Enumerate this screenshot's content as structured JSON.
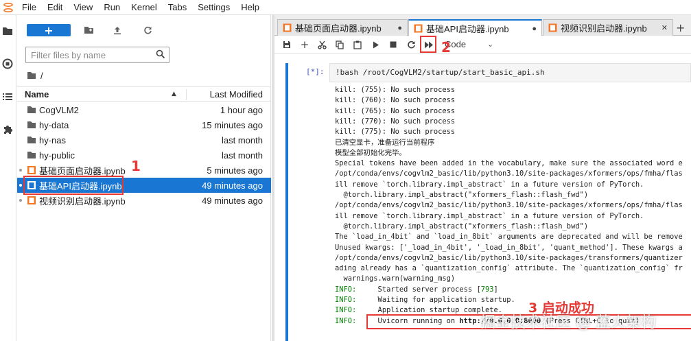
{
  "menu": {
    "items": [
      "File",
      "Edit",
      "View",
      "Run",
      "Kernel",
      "Tabs",
      "Settings",
      "Help"
    ]
  },
  "filebrowser": {
    "new_label": "+",
    "filter_placeholder": "Filter files by name",
    "breadcrumb": "/",
    "columns": {
      "name": "Name",
      "modified": "Last Modified"
    },
    "files": [
      {
        "name": "CogVLM2",
        "modified": "1 hour ago",
        "type": "folder"
      },
      {
        "name": "hy-data",
        "modified": "15 minutes ago",
        "type": "folder"
      },
      {
        "name": "hy-nas",
        "modified": "last month",
        "type": "folder"
      },
      {
        "name": "hy-public",
        "modified": "last month",
        "type": "folder"
      },
      {
        "name": "基础页面启动器.ipynb",
        "modified": "5 minutes ago",
        "type": "notebook",
        "running": true
      },
      {
        "name": "基础API启动器.ipynb",
        "modified": "49 minutes ago",
        "type": "notebook",
        "running": true,
        "selected": true
      },
      {
        "name": "视频识别启动器.ipynb",
        "modified": "49 minutes ago",
        "type": "notebook",
        "running": true
      }
    ]
  },
  "tabs": [
    {
      "label": "基础页面启动器.ipynb",
      "close": "●"
    },
    {
      "label": "基础API启动器.ipynb",
      "close": "●",
      "active": true
    },
    {
      "label": "视频识别启动器.ipynb",
      "close": "✕"
    }
  ],
  "tab_add": "+",
  "notebook": {
    "cell_type": "Code",
    "prompt": "[*]:",
    "input": "!bash /root/CogVLM2/startup/start_basic_api.sh",
    "output": [
      {
        "text": "kill: (755): No such process"
      },
      {
        "text": "kill: (760): No such process"
      },
      {
        "text": "kill: (765): No such process"
      },
      {
        "text": "kill: (770): No such process"
      },
      {
        "text": "kill: (775): No such process"
      },
      {
        "text": "已清空显卡，准备运行当前程序"
      },
      {
        "text": "模型全部初始化完毕。"
      },
      {
        "text": "Special tokens have been added in the vocabulary, make sure the associated word e"
      },
      {
        "text": "/opt/conda/envs/cogvlm2_basic/lib/python3.10/site-packages/xformers/ops/fmha/flas"
      },
      {
        "text": "ill remove `torch.library.impl_abstract` in a future version of PyTorch."
      },
      {
        "text": "  @torch.library.impl_abstract(\"xformers_flash::flash_fwd\")"
      },
      {
        "text": "/opt/conda/envs/cogvlm2_basic/lib/python3.10/site-packages/xformers/ops/fmha/flas"
      },
      {
        "text": "ill remove `torch.library.impl_abstract` in a future version of PyTorch."
      },
      {
        "text": "  @torch.library.impl_abstract(\"xformers_flash::flash_bwd\")"
      },
      {
        "text": "The `load_in_4bit` and `load_in_8bit` arguments are deprecated and will be remove"
      },
      {
        "text": "Unused kwargs: ['_load_in_4bit', '_load_in_8bit', 'quant_method']. These kwargs a"
      },
      {
        "text": "/opt/conda/envs/cogvlm2_basic/lib/python3.10/site-packages/transformers/quantizer"
      },
      {
        "text": "ading already has a `quantization_config` attribute. The `quantization_config` fr"
      },
      {
        "text": "  warnings.warn(warning_msg)"
      },
      {
        "level": "INFO:",
        "text": "     Started server process [",
        "pid": "793",
        "tail": "]"
      },
      {
        "level": "INFO:",
        "text": "     Waiting for application startup."
      },
      {
        "level": "INFO:",
        "text": "     Application startup complete."
      },
      {
        "level": "INFO:",
        "text": "     Uvicorn running on ",
        "url": "http://0.0.0.0:8000",
        "tail": " (Press CTRL+C to quit)"
      }
    ]
  },
  "annotations": {
    "one": "1",
    "two": "2",
    "three": "3 启动成功"
  },
  "watermark": "掘金技术社区 @ 蓝火架构",
  "colors": {
    "accent": "#1976d2",
    "annotation": "#e53935",
    "info": "#008000"
  }
}
